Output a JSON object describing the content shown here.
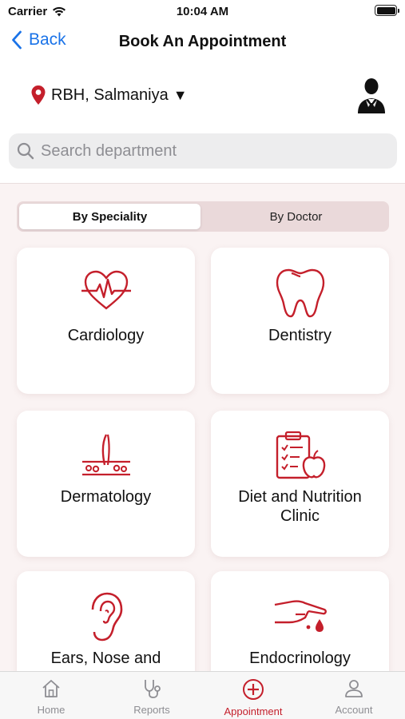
{
  "status_bar": {
    "carrier": "Carrier",
    "time": "10:04 AM"
  },
  "nav": {
    "back_label": "Back",
    "title": "Book An Appointment"
  },
  "location": {
    "label": "RBH, Salmaniya",
    "caret": "▼"
  },
  "search": {
    "placeholder": "Search department"
  },
  "segment": {
    "options": [
      "By Speciality",
      "By Doctor"
    ],
    "selected": "By Speciality"
  },
  "departments": [
    {
      "name": "Cardiology",
      "icon": "heart-pulse-icon"
    },
    {
      "name": "Dentistry",
      "icon": "tooth-icon"
    },
    {
      "name": "Dermatology",
      "icon": "skin-follicle-icon"
    },
    {
      "name": "Diet and Nutrition Clinic",
      "icon": "clipboard-apple-icon"
    },
    {
      "name": "Ears, Nose and",
      "icon": "ear-icon"
    },
    {
      "name": "Endocrinology",
      "icon": "hand-drop-icon"
    }
  ],
  "tab_bar": {
    "tabs": [
      {
        "label": "Home",
        "icon": "home-icon"
      },
      {
        "label": "Reports",
        "icon": "stethoscope-icon"
      },
      {
        "label": "Appointment",
        "icon": "plus-circle-icon"
      },
      {
        "label": "Account",
        "icon": "user-icon"
      }
    ],
    "active": "Appointment"
  },
  "colors": {
    "accent": "#c41f2b",
    "link": "#1a73e8",
    "content_bg": "#faf3f3",
    "segment_bg": "#ead9da"
  }
}
